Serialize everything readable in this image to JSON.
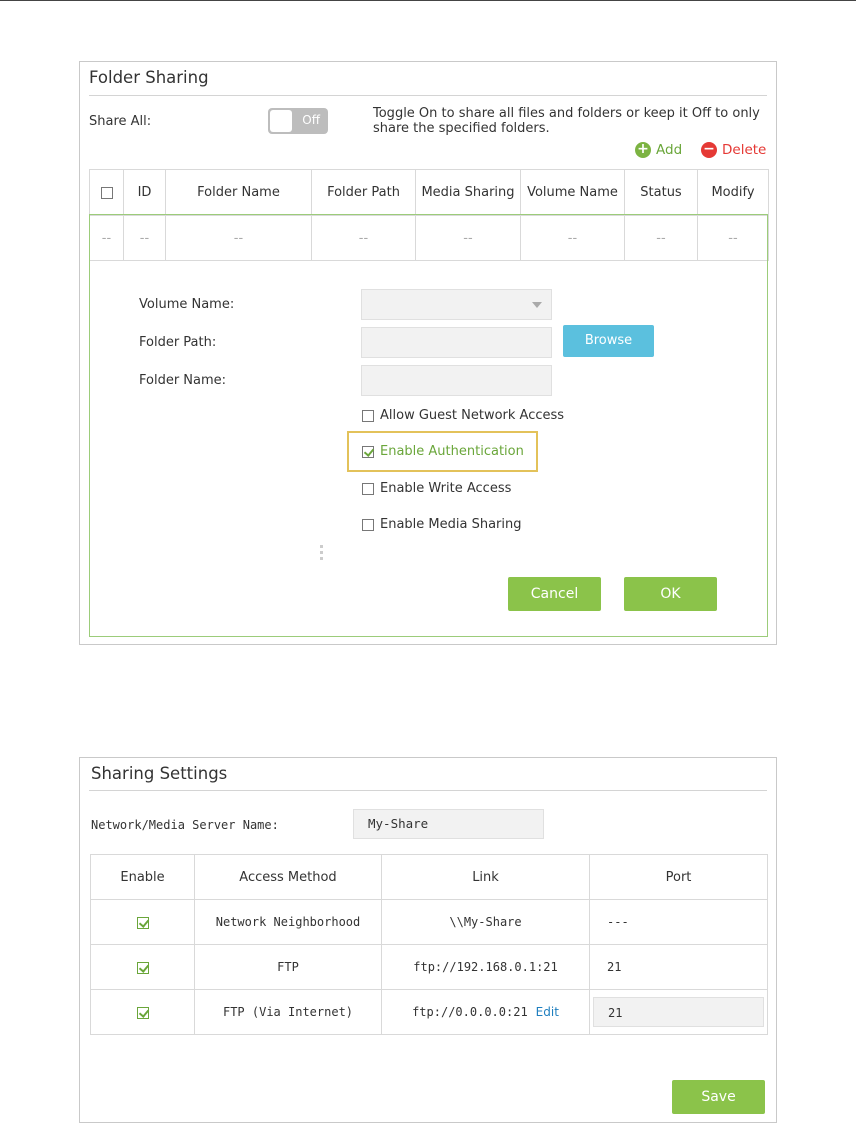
{
  "folder_sharing": {
    "title": "Folder Sharing",
    "share_all_label": "Share All:",
    "toggle_state": "Off",
    "hint": "Toggle On to share all files and folders or keep it Off to only share the specified folders.",
    "add_label": "Add",
    "delete_label": "Delete",
    "columns": [
      "ID",
      "Folder Name",
      "Folder Path",
      "Media Sharing",
      "Volume Name",
      "Status",
      "Modify"
    ],
    "empty_row": [
      "--",
      "--",
      "--",
      "--",
      "--",
      "--",
      "--",
      "--"
    ],
    "form": {
      "volume_name_label": "Volume Name:",
      "folder_path_label": "Folder Path:",
      "folder_name_label": "Folder Name:",
      "browse_label": "Browse",
      "options": [
        {
          "label": "Allow Guest Network Access",
          "checked": false
        },
        {
          "label": "Enable Authentication",
          "checked": true
        },
        {
          "label": "Enable Write Access",
          "checked": false
        },
        {
          "label": "Enable Media Sharing",
          "checked": false
        }
      ],
      "cancel_label": "Cancel",
      "ok_label": "OK"
    }
  },
  "sharing_settings": {
    "title": "Sharing Settings",
    "server_name_label": "Network/Media Server Name:",
    "server_name_value": "My-Share",
    "columns": [
      "Enable",
      "Access Method",
      "Link",
      "Port"
    ],
    "rows": [
      {
        "enabled": true,
        "method": "Network Neighborhood",
        "link": "\\\\My-Share",
        "port": "---"
      },
      {
        "enabled": true,
        "method": "FTP",
        "link": "ftp://192.168.0.1:21",
        "port": "21"
      },
      {
        "enabled": true,
        "method": "FTP (Via Internet)",
        "link": "ftp://0.0.0.0:21",
        "edit": "Edit",
        "port": "21"
      }
    ],
    "save_label": "Save"
  },
  "colors": {
    "green": "#8bc34a",
    "blue": "#5bc0de",
    "red": "#e53935",
    "highlight": "#e3c25a"
  }
}
